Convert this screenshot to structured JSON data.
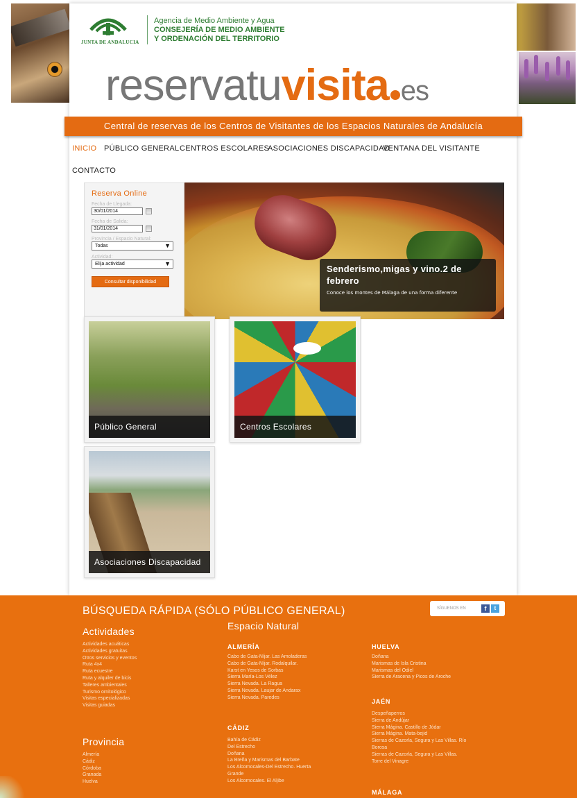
{
  "header": {
    "logo_org": "JUNTA DE ANDALUCIA",
    "agency_line1": "Agencia de Medio Ambiente y Agua",
    "agency_line2": "CONSEJERÍA DE MEDIO AMBIENTE",
    "agency_line3": "Y ORDENACIÓN DEL TERRITORIO",
    "brand_part1": "reservatu",
    "brand_part2": "visita",
    "brand_part3": "es",
    "tagline": "Central de reservas de los Centros de Visitantes de los Espacios Naturales de Andalucía"
  },
  "nav": {
    "items": [
      {
        "label": "INICIO"
      },
      {
        "label": "PÚBLICO GENERAL"
      },
      {
        "label": "CENTROS ESCOLARES"
      },
      {
        "label": "ASOCIACIONES DISCAPACIDAD"
      },
      {
        "label": "VENTANA DEL VISITANTE"
      },
      {
        "label": "CONTACTO"
      }
    ]
  },
  "reserva": {
    "title": "Reserva Online",
    "arrival_label": "Fecha de Llegada:",
    "arrival_value": "30/01/2014",
    "departure_label": "Fecha de Salida:",
    "departure_value": "31/01/2014",
    "province_label": "Provincia / Espacio Natural:",
    "province_value": "Todas",
    "activity_label": "Actividad:",
    "activity_value": "Elija actividad",
    "submit_label": "Consultar disponibilidad"
  },
  "slider": {
    "title": "Senderismo,migas y vino.2 de febrero",
    "subtitle": "Conoce los montes de Málaga de una forma diferente"
  },
  "cards": [
    {
      "label": "Público General"
    },
    {
      "label": "Centros Escolares"
    },
    {
      "label": "Asociaciones Discapacidad"
    }
  ],
  "footer": {
    "title": "BÚSQUEDA RÁPIDA (SÓLO PÚBLICO GENERAL)",
    "social_label": "SÍGUENOS EN",
    "social_fb": "f",
    "social_tw": "t",
    "activities_heading": "Actividades",
    "activities": [
      "Actividades acuáticas",
      "Actividades gratuitas",
      "Otros servicios y eventos",
      "Ruta 4x4",
      "Ruta ecuestre",
      "Ruta y alquiler de bicis",
      "Talleres ambientales",
      "Turismo ornitológico",
      "Visitas especializadas",
      "Visitas guiadas"
    ],
    "province_heading": "Provincia",
    "provinces": [
      "Almería",
      "Cádiz",
      "Córdoba",
      "Granada",
      "Huelva"
    ],
    "espacio_heading": "Espacio Natural",
    "almeria_heading": "ALMERÍA",
    "almeria": [
      "Cabo de Gata-Níjar. Las Amoladeras",
      "Cabo de Gata-Níjar. Rodalquilar.",
      "Karst en Yesos de Sorbas",
      "Sierra María-Los Vélez",
      "Sierra Nevada. La Ragua",
      "Sierra Nevada. Laujar de Andarax",
      "Sierra Nevada. Paredes"
    ],
    "cadiz_heading": "CÁDIZ",
    "cadiz": [
      "Bahía de Cádiz",
      "Del Estrecho",
      "Doñana",
      "La Breña y Marismas del Barbate",
      "Los Alcornocales-Del Estrecho. Huerta",
      "Grande",
      "Los Alcornocales. El Aljibe"
    ],
    "huelva_heading": "HUELVA",
    "huelva": [
      "Doñana",
      "Marismas de Isla Cristina",
      "Marismas del Odiel",
      "Sierra de Aracena y Picos de Aroche"
    ],
    "jaen_heading": "JAÉN",
    "jaen": [
      "Despeñaperros",
      "Sierra de Andújar",
      "Sierra Mágina. Castillo de Jódar",
      "Sierra Mágina. Mata-bejid",
      "Sierras de Cazorla, Segura y Las Villas. Río",
      "Borosa",
      "Sierras de Cazorla, Segura y Las Villas.",
      "Torre del Vinagre"
    ],
    "malaga_heading": "MÁLAGA"
  },
  "colors": {
    "accent": "#e46b12",
    "footer_bg": "#e8700f",
    "junta_green": "#2e7d32"
  }
}
